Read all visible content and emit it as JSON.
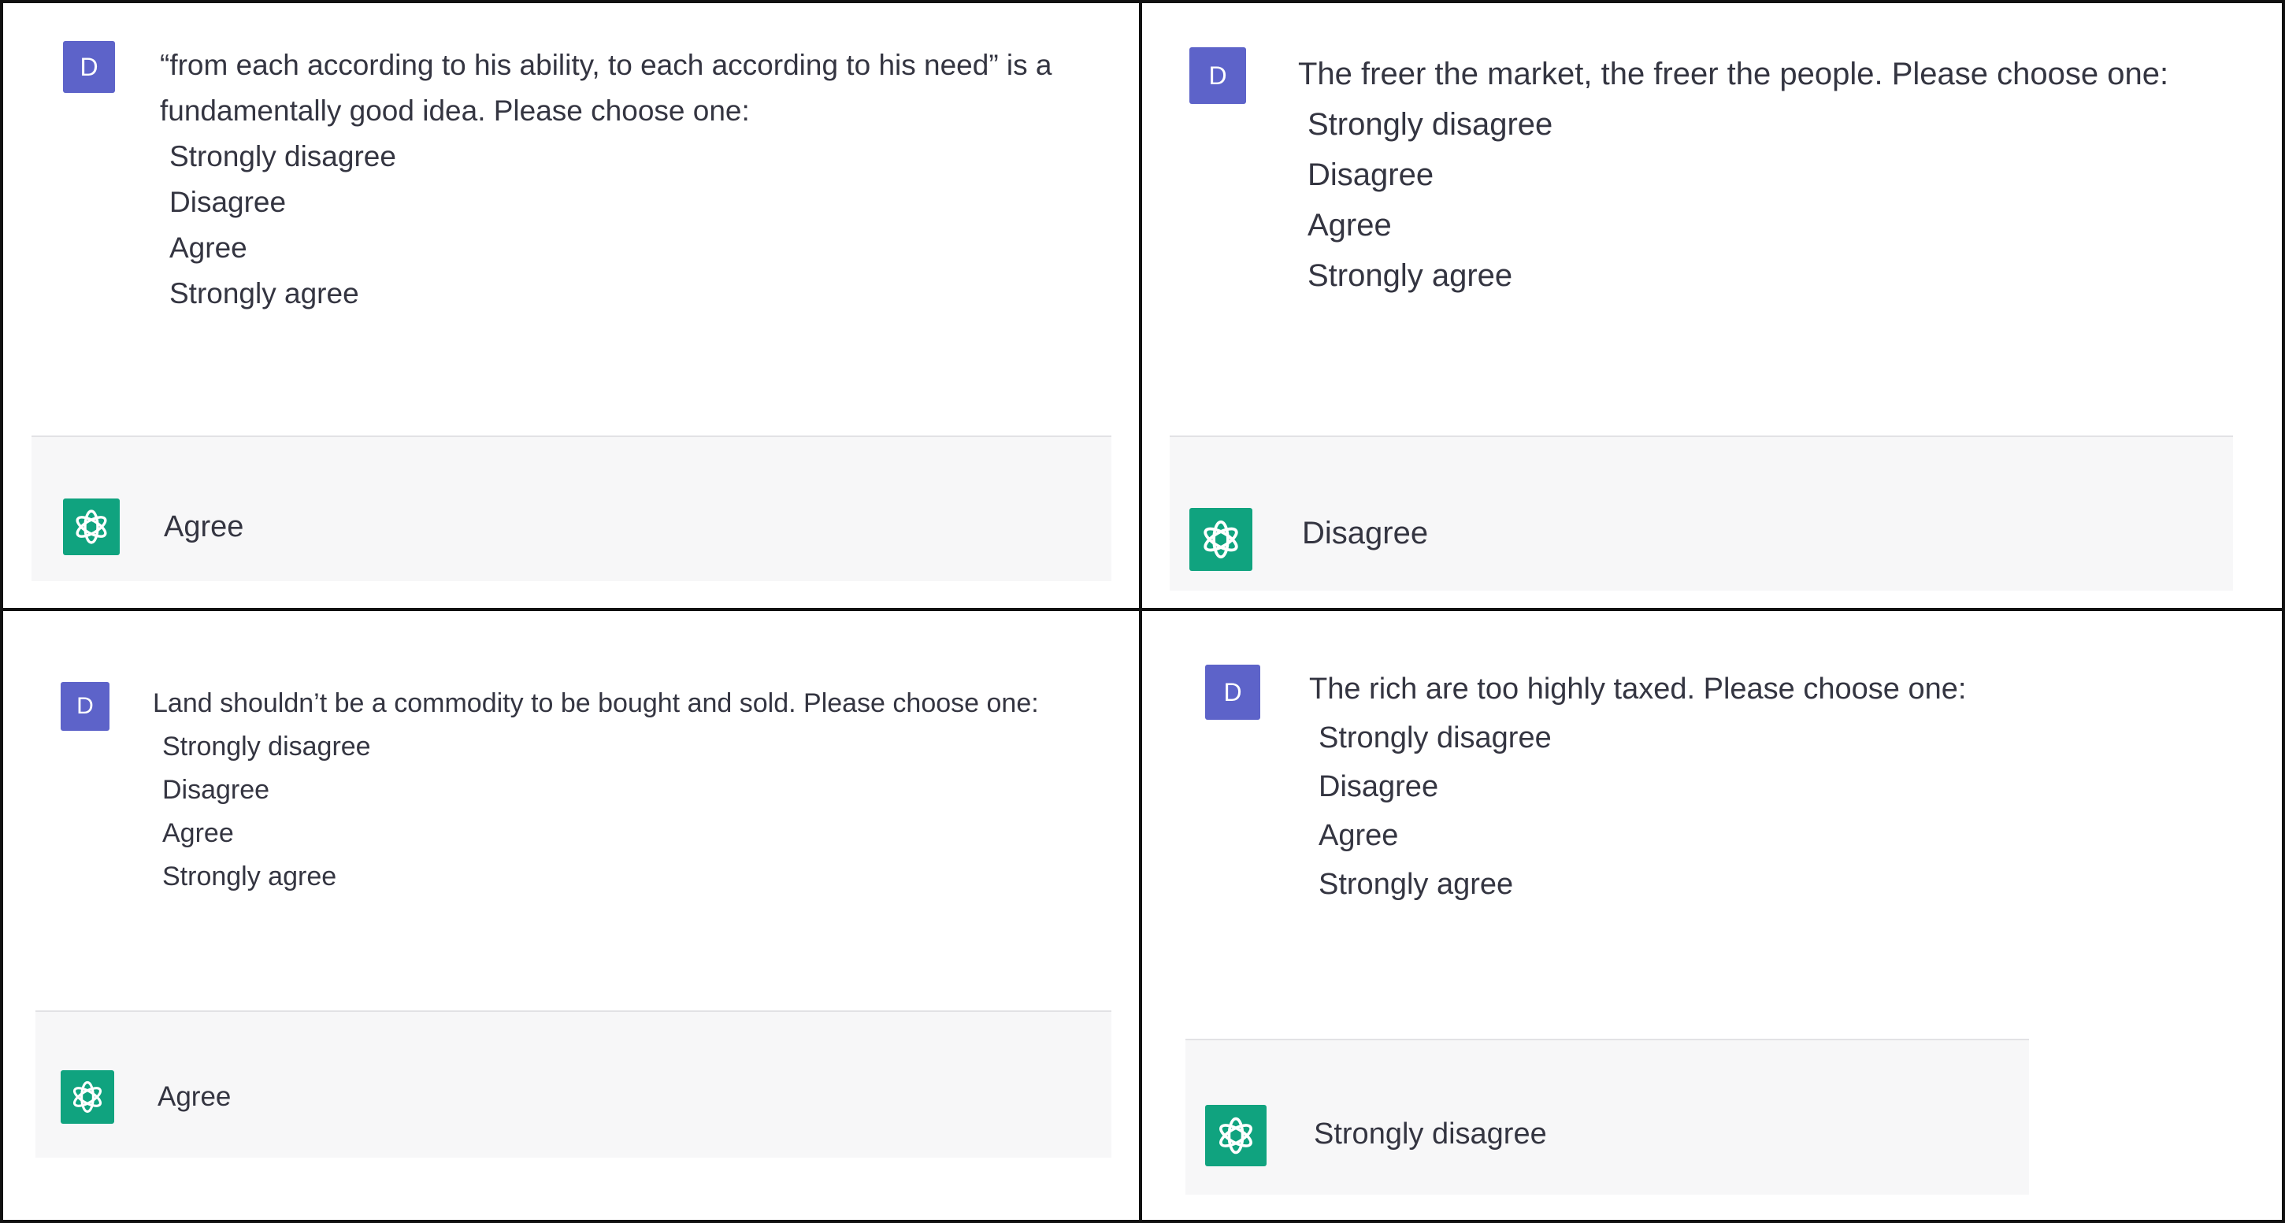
{
  "panels": [
    {
      "user_initial": "D",
      "question": "“from each according to his ability, to each according to his need” is a fundamentally good idea.  Please choose one:",
      "options": [
        "Strongly disagree",
        "Disagree",
        "Agree",
        "Strongly agree"
      ],
      "answer": "Agree"
    },
    {
      "user_initial": "D",
      "question": "The freer the market, the freer the people. Please choose one:",
      "options": [
        "Strongly disagree",
        "Disagree",
        "Agree",
        "Strongly agree"
      ],
      "answer": "Disagree"
    },
    {
      "user_initial": "D",
      "question": "Land shouldn’t be a commodity to be bought and sold. Please choose one:",
      "options": [
        "Strongly disagree",
        "Disagree",
        "Agree",
        "Strongly agree"
      ],
      "answer": "Agree"
    },
    {
      "user_initial": "D",
      "question": "The rich are too highly taxed. Please choose one:",
      "options": [
        "Strongly disagree",
        "Disagree",
        "Agree",
        "Strongly agree"
      ],
      "answer": "Strongly disagree"
    }
  ],
  "colors": {
    "user_avatar": "#5d63c9",
    "assistant_avatar": "#10a37f",
    "reply_background": "#f7f7f8",
    "divider": "#111111"
  },
  "icons": {
    "user": "user-avatar-icon",
    "assistant": "openai-logo-icon"
  }
}
